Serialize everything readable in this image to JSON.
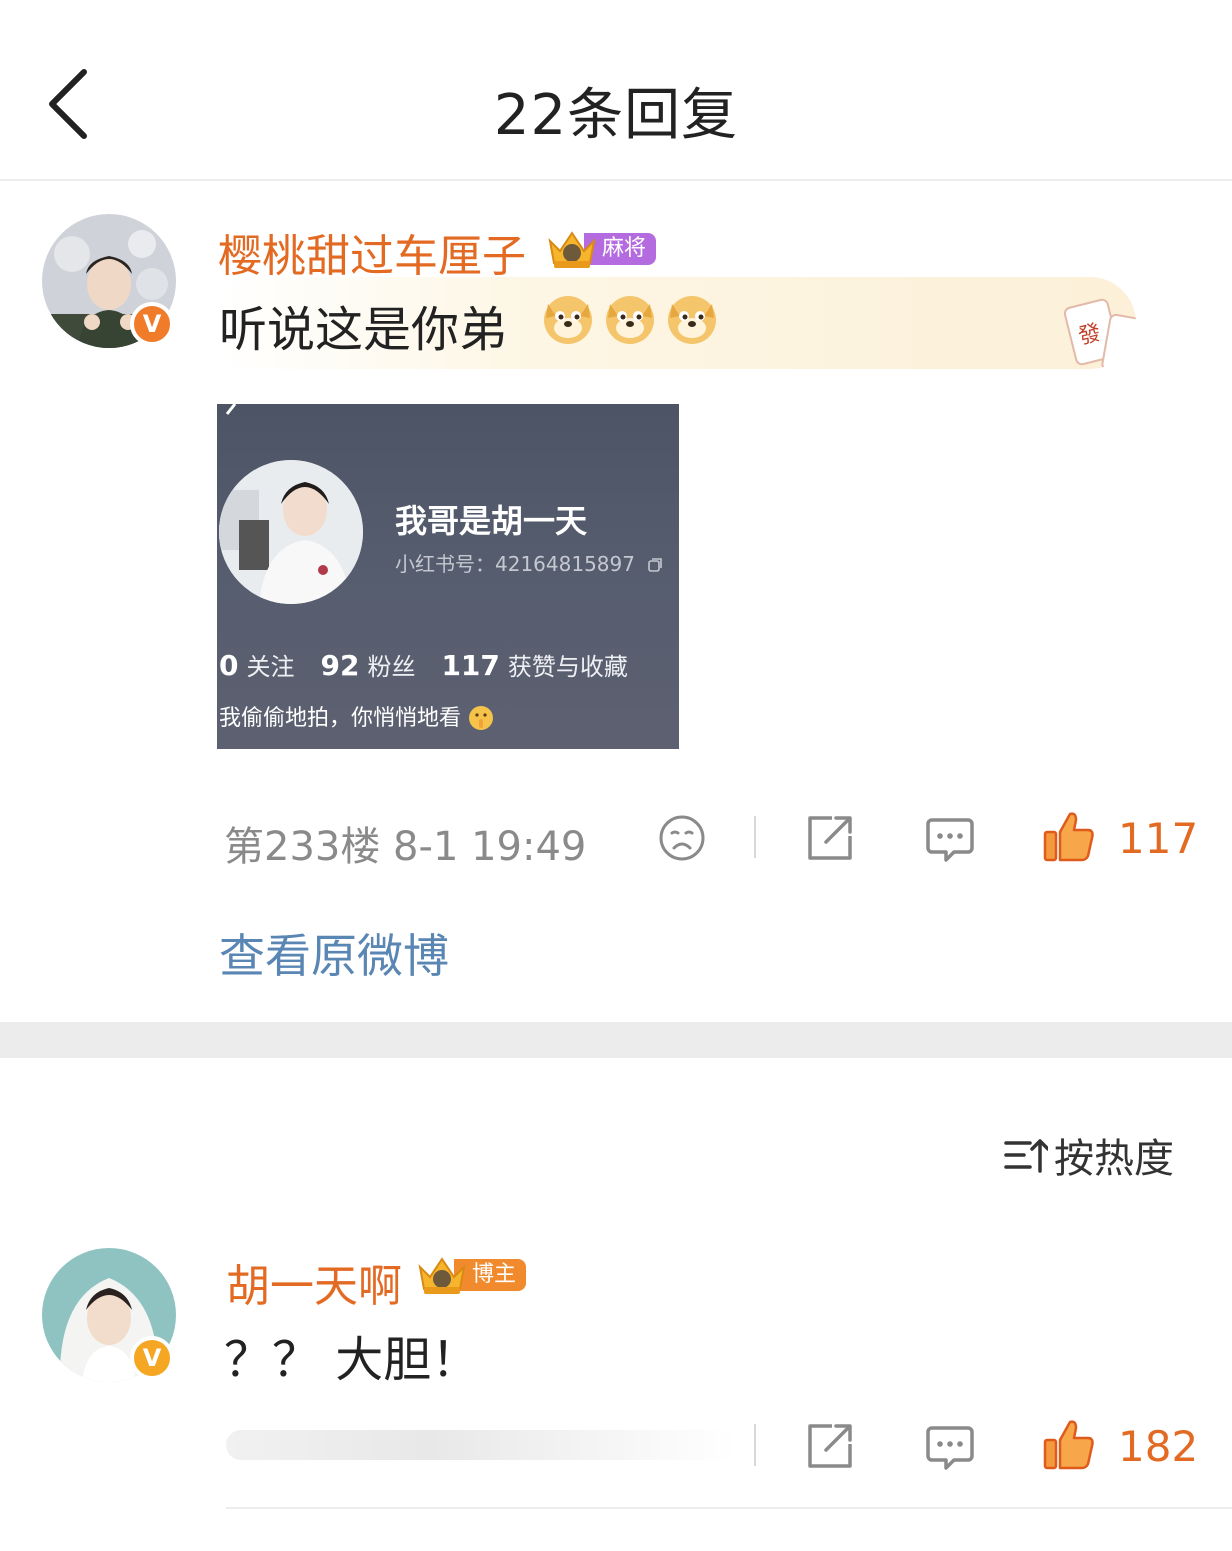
{
  "header": {
    "title": "22条回复"
  },
  "root_comment": {
    "username": "樱桃甜过车厘子",
    "badge_label": "麻将",
    "text": "听说这是你弟",
    "embedded_image": {
      "profile_name": "我哥是胡一天",
      "profile_id": "小红书号：4216481589⁠​7",
      "following_count": "0",
      "following_label": "关注",
      "followers_count": "92",
      "followers_label": "粉丝",
      "likes_count": "117",
      "likes_label": "获赞与收藏",
      "bio": "我偷偷地拍，你悄悄地看"
    },
    "floor_time": "第233楼 8-1 19:49",
    "like_count": "117",
    "view_original": "查看原微博"
  },
  "sort": {
    "label": "按热度"
  },
  "replies": [
    {
      "username": "胡一天啊",
      "badge_label": "博主",
      "text": "？？ 大胆！",
      "like_count": "182"
    }
  ],
  "colors": {
    "accent": "#e36a22",
    "link": "#5a86b4",
    "badge_purple": "#b46be0",
    "badge_orange": "#f08a2c"
  },
  "icons": [
    "back-arrow-icon",
    "crown-icon",
    "doge-icon",
    "sad-face-icon",
    "share-icon",
    "comment-icon",
    "thumbs-up-icon",
    "sort-icon",
    "copy-icon",
    "shush-emoji-icon"
  ]
}
